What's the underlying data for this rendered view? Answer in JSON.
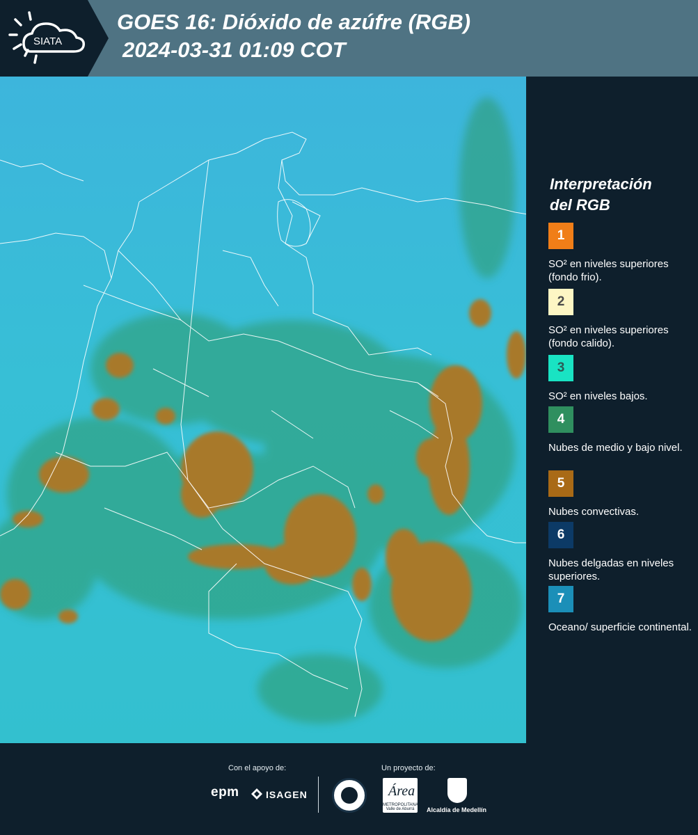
{
  "header": {
    "logo_text": "SIATA",
    "title": "GOES 16: Dióxido de azúfre (RGB)",
    "datetime": "2024-03-31 01:09 COT"
  },
  "legend": {
    "title_line1": "Interpretación",
    "title_line2": "del RGB",
    "items": [
      {
        "number": "1",
        "color": "#f07e18",
        "number_color": "#ffffff",
        "text": "SO² en niveles superiores (fondo frio)."
      },
      {
        "number": "2",
        "color": "#fdf6c4",
        "number_color": "#4a4a4a",
        "text": "SO² en niveles superiores (fondo calido)."
      },
      {
        "number": "3",
        "color": "#19e3c3",
        "number_color": "#2c5a55",
        "text": "SO² en niveles bajos."
      },
      {
        "number": "4",
        "color": "#2f8f5f",
        "number_color": "#ffffff",
        "text": "Nubes de medio y bajo nivel."
      },
      {
        "number": "5",
        "color": "#a96a16",
        "number_color": "#ffffff",
        "text": "Nubes convectivas."
      },
      {
        "number": "6",
        "color": "#0c3a66",
        "number_color": "#ffffff",
        "text": "Nubes delgadas en niveles superiores."
      },
      {
        "number": "7",
        "color": "#1b8fb8",
        "number_color": "#ffffff",
        "text": "Oceano/ superficie continental."
      }
    ]
  },
  "footer": {
    "support_label": "Con el apoyo de:",
    "project_label": "Un proyecto de:",
    "epm": "epm",
    "isagen": "ISAGEN",
    "area_logo": "Área",
    "area_caption": "METROPOLITANA Valle de Aburrá",
    "alcaldia": "Alcaldía de Medellín"
  },
  "colors": {
    "header_bg": "#4f7383",
    "page_bg": "#0e1f2c",
    "map_sky": "#2fb3d6",
    "cloud_convective": "#a87a22",
    "cloud_mid": "#2f9060"
  }
}
